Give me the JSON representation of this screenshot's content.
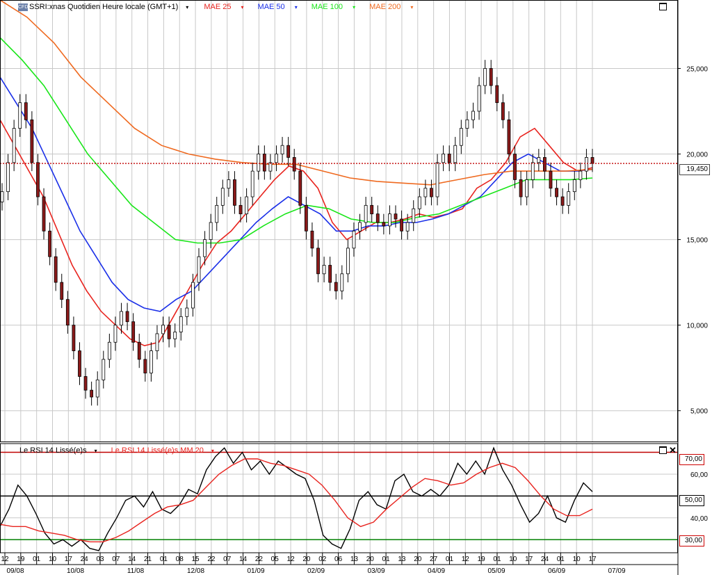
{
  "header": {
    "symbol_label": "SSRI:xnas Quotidien Heure locale (GMT+1)",
    "studies": [
      {
        "label": "MAE 25",
        "color": "#e8231e"
      },
      {
        "label": "MAE 50",
        "color": "#1a2fe8"
      },
      {
        "label": "MAE 100",
        "color": "#19e619"
      },
      {
        "label": "MAE 200",
        "color": "#ef6a20"
      }
    ]
  },
  "rsi_header": {
    "rsi_label": "Le RSI 14 Lissé(e)s",
    "rsi_ma_label": "Le RSI 14 Lissé(e)s MM 20"
  },
  "last_price_label": "19,450",
  "rsi_levels": {
    "upper": "70,00",
    "mid": "50,00",
    "lower": "30,00"
  },
  "colors": {
    "grid": "#c8c8c8",
    "up": "#ffffff",
    "down": "#8b1a1a",
    "price_line": "#c00000",
    "rsi": "#000000",
    "rsi_ma": "#e8231e",
    "rsi_70": "#c00000",
    "rsi_30": "#008000"
  },
  "chart_data": [
    {
      "type": "candlestick",
      "title": "SSRI:xnas Quotidien",
      "y_ticks": [
        "5,000",
        "10,000",
        "15,000",
        "20,000",
        "25,000"
      ],
      "y_tick_values": [
        5,
        10,
        15,
        20,
        25
      ],
      "ylim": [
        3.2,
        29
      ],
      "last_price": 19.45,
      "close_series": [
        17.8,
        19.5,
        21.5,
        23.0,
        22.0,
        19.5,
        17.5,
        15.5,
        14.0,
        12.5,
        11.5,
        10.0,
        8.5,
        7.0,
        6.2,
        5.8,
        6.8,
        8.0,
        9.0,
        10.0,
        10.8,
        10.2,
        9.0,
        8.0,
        7.2,
        8.5,
        9.5,
        10.0,
        9.2,
        9.6,
        10.5,
        11.0,
        12.5,
        14.0,
        15.0,
        16.0,
        17.0,
        18.0,
        18.5,
        17.0,
        16.5,
        17.5,
        19.0,
        20.0,
        19.0,
        19.5,
        20.0,
        20.5,
        19.8,
        19.0,
        17.0,
        15.5,
        14.5,
        13.0,
        13.5,
        12.5,
        12.0,
        13.0,
        14.5,
        15.5,
        16.0,
        17.0,
        16.5,
        16.0,
        15.8,
        16.5,
        16.2,
        15.5,
        16.0,
        16.8,
        17.5,
        18.0,
        17.5,
        19.5,
        20.0,
        19.5,
        20.5,
        21.5,
        22.0,
        22.5,
        24.0,
        25.0,
        24.0,
        23.0,
        22.0,
        20.0,
        18.5,
        17.5,
        18.5,
        19.5,
        19.8,
        19.0,
        18.0,
        17.5,
        17.0,
        17.8,
        18.5,
        19.0,
        19.8,
        19.45
      ],
      "moving_averages": [
        {
          "name": "MAE 25",
          "color": "#e8231e",
          "values": [
            22.0,
            20.5,
            19.0,
            17.5,
            15.5,
            13.5,
            12.0,
            10.8,
            10.0,
            9.2,
            8.8,
            9.0,
            10.5,
            12.0,
            13.5,
            14.8,
            15.5,
            16.5,
            17.5,
            18.5,
            19.3,
            19.0,
            18.0,
            16.0,
            15.0,
            15.5,
            16.0,
            16.0,
            16.2,
            16.5,
            16.3,
            16.5,
            16.8,
            18.0,
            18.5,
            19.5,
            21.0,
            21.5,
            20.5,
            19.5,
            19.0,
            19.2
          ]
        },
        {
          "name": "MAE 50",
          "color": "#1a2fe8",
          "values": [
            24.5,
            23.0,
            21.5,
            19.5,
            17.5,
            15.5,
            14.0,
            12.5,
            11.5,
            11.0,
            10.8,
            11.5,
            12.0,
            13.0,
            14.0,
            15.0,
            16.0,
            16.8,
            17.5,
            17.0,
            16.5,
            15.5,
            15.5,
            15.8,
            15.8,
            16.0,
            16.0,
            16.2,
            16.5,
            17.0,
            17.5,
            18.5,
            19.5,
            20.0,
            19.5,
            19.0,
            19.0,
            19.1
          ]
        },
        {
          "name": "MAE 100",
          "color": "#19e619",
          "values": [
            26.8,
            25.5,
            24.0,
            22.0,
            20.0,
            18.5,
            17.0,
            16.0,
            15.0,
            14.8,
            14.8,
            15.0,
            15.8,
            16.5,
            17.0,
            16.8,
            16.2,
            16.0,
            16.0,
            16.3,
            16.5,
            17.0,
            17.5,
            18.0,
            18.5,
            18.5,
            18.5,
            18.6
          ]
        },
        {
          "name": "MAE 200",
          "color": "#ef6a20",
          "values": [
            29.0,
            28.0,
            26.5,
            24.5,
            23.0,
            21.5,
            20.5,
            20.0,
            19.7,
            19.5,
            19.4,
            19.4,
            19.0,
            18.6,
            18.4,
            18.3,
            18.2,
            18.5,
            18.8,
            19.0,
            19.0,
            19.0,
            19.1
          ]
        }
      ],
      "x_day_labels": [
        "12",
        "19",
        "01",
        "10",
        "17",
        "24",
        "03",
        "07",
        "14",
        "21",
        "01",
        "08",
        "15",
        "22",
        "07",
        "14",
        "22",
        "05",
        "12",
        "20",
        "02",
        "06",
        "13",
        "20",
        "01",
        "13",
        "20",
        "27",
        "01",
        "12",
        "19",
        "01",
        "10",
        "17",
        "24",
        "01",
        "10",
        "17"
      ],
      "x_month_labels": [
        "09/08",
        "10/08",
        "11/08",
        "12/08",
        "01/09",
        "02/09",
        "03/09",
        "04/09",
        "05/09",
        "06/09",
        "07/09"
      ]
    },
    {
      "type": "line",
      "title": "Le RSI 14 Lissé(e)s",
      "y_ticks": [
        "40,00",
        "60,00"
      ],
      "y_tick_values": [
        40,
        60
      ],
      "levels": [
        70,
        50,
        30
      ],
      "ylim": [
        24,
        74
      ],
      "series": [
        {
          "name": "Le RSI 14 Lissé(e)s",
          "color": "#000000",
          "values": [
            36,
            44,
            55,
            50,
            42,
            33,
            28,
            30,
            27,
            30,
            26,
            25,
            33,
            40,
            48,
            50,
            45,
            52,
            44,
            42,
            46,
            53,
            51,
            62,
            68,
            72,
            65,
            70,
            62,
            66,
            60,
            66,
            63,
            60,
            58,
            48,
            32,
            28,
            26,
            35,
            48,
            52,
            46,
            44,
            57,
            60,
            52,
            50,
            53,
            50,
            55,
            65,
            60,
            66,
            60,
            72,
            62,
            55,
            46,
            38,
            42,
            50,
            40,
            38,
            48,
            56,
            52
          ]
        },
        {
          "name": "Le RSI 14 Lissé(e)s MM 20",
          "color": "#e8231e",
          "values": [
            37,
            36,
            36,
            34,
            33,
            32,
            30,
            29,
            29,
            31,
            34,
            38,
            42,
            45,
            46,
            48,
            54,
            60,
            64,
            67,
            67,
            65,
            64,
            62,
            60,
            55,
            48,
            40,
            36,
            38,
            44,
            49,
            54,
            58,
            57,
            55,
            56,
            60,
            63,
            65,
            63,
            57,
            50,
            44,
            41,
            41,
            44
          ]
        }
      ]
    }
  ]
}
